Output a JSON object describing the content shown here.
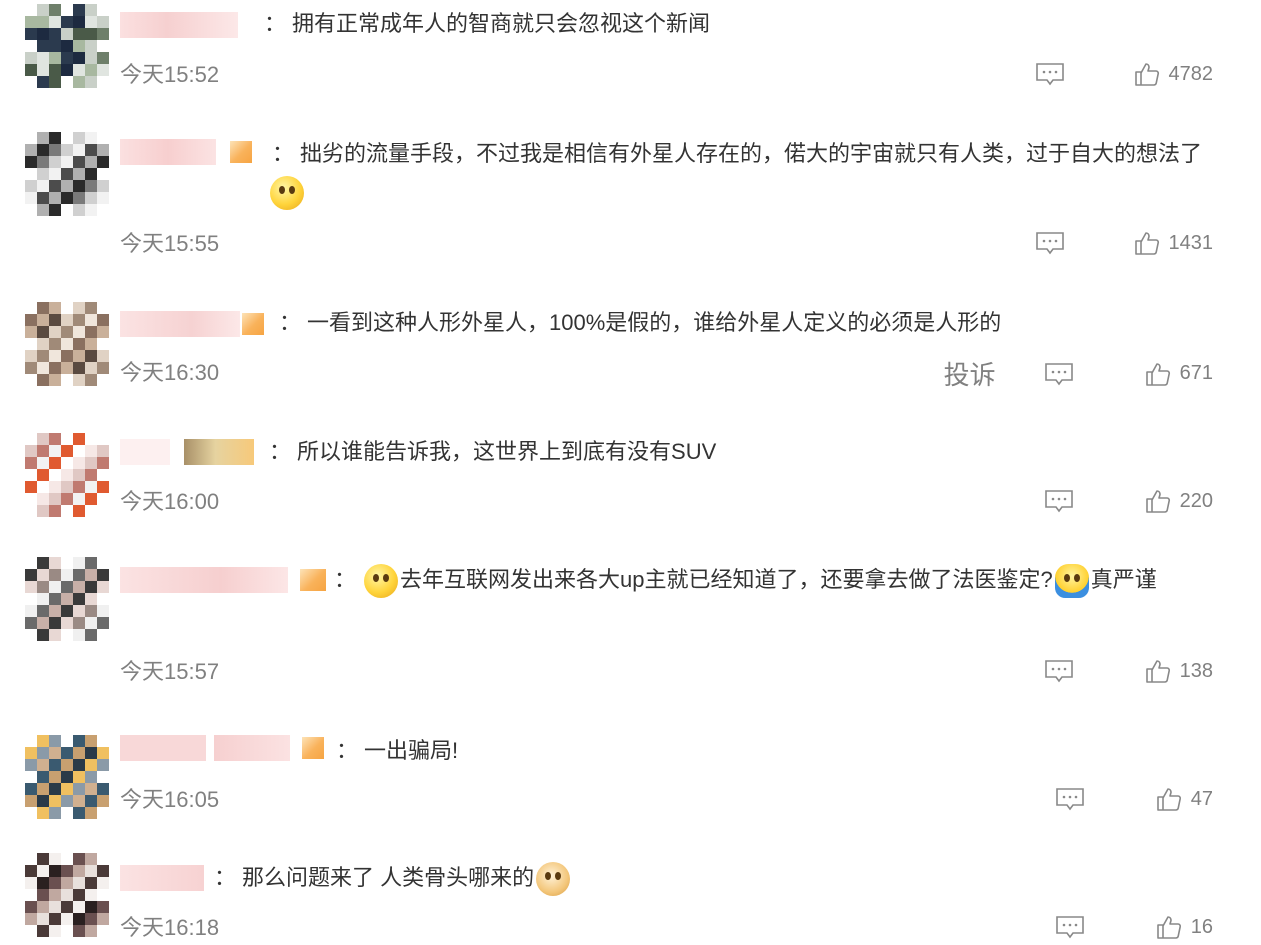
{
  "comments": [
    {
      "text": "拥有正常成年人的智商就只会忽视这个新闻",
      "emojis": [],
      "time": "今天15:52",
      "likes": "4782",
      "report": ""
    },
    {
      "text": "拙劣的流量手段，不过我是相信有外星人存在的，偌大的宇宙就只有人类，过于自大的想法了",
      "emojis": [
        "thinking-emoji"
      ],
      "time": "今天15:55",
      "likes": "1431",
      "report": ""
    },
    {
      "text": "一看到这种人形外星人，100%是假的，谁给外星人定义的必须是人形的",
      "emojis": [],
      "time": "今天16:30",
      "likes": "671",
      "report": "投诉"
    },
    {
      "text": "所以谁能告诉我，这世界上到底有没有SUV",
      "emojis": [],
      "time": "今天16:00",
      "likes": "220",
      "report": ""
    },
    {
      "text_a": "去年互联网发出来各大up主就已经知道了，还要拿去做了法医鉴定?",
      "text_b": "真严谨",
      "emojis": [
        "yummy-emoji",
        "shrug-emoji",
        "thinking-emoji"
      ],
      "time": "今天15:57",
      "likes": "138",
      "report": ""
    },
    {
      "text": "一出骗局!",
      "emojis": [],
      "time": "今天16:05",
      "likes": "47",
      "report": ""
    },
    {
      "text": "那么问题来了 人类骨头哪来的",
      "emojis": [
        "doge-emoji"
      ],
      "time": "今天16:18",
      "likes": "16",
      "report": ""
    }
  ],
  "separator": "：",
  "colors": {
    "text": "#333333",
    "meta": "#808080",
    "badge": "#f6a442"
  }
}
